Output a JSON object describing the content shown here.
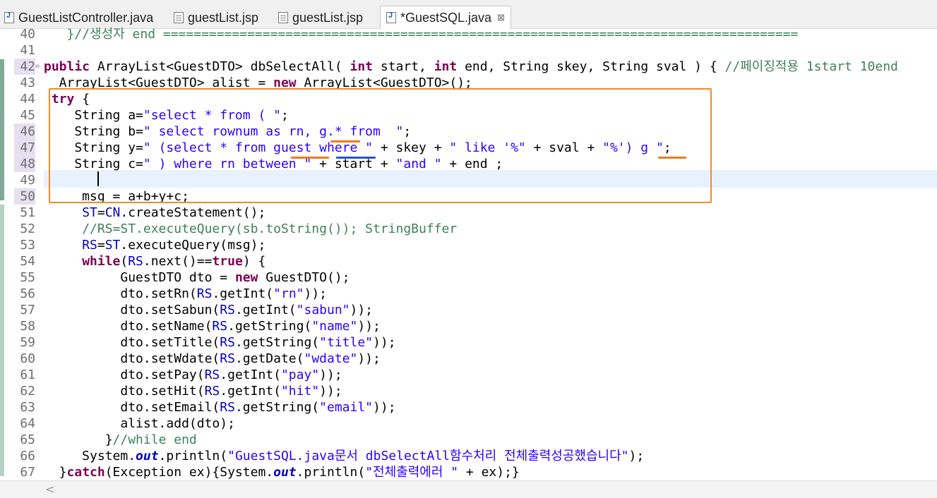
{
  "tabs": [
    {
      "label": "GuestListController.java",
      "type": "java-icon",
      "active": false
    },
    {
      "label": "guestList.jsp",
      "type": "jsp-icon",
      "active": false
    },
    {
      "label": "guestList.jsp",
      "type": "jsp-icon",
      "active": false
    },
    {
      "label": "*GuestSQL.java",
      "type": "java-icon",
      "active": true,
      "close": "⊠"
    }
  ],
  "lines": [
    {
      "n": "40",
      "segs": [
        [
          "cm",
          "   }//생성자 end ==================================================================================="
        ]
      ]
    },
    {
      "n": "41",
      "segs": [
        [
          "",
          ""
        ]
      ]
    },
    {
      "n": "42",
      "segs": [
        [
          "kw",
          "public"
        ],
        [
          "",
          " ArrayList<GuestDTO> dbSelectAll( "
        ],
        [
          "kw",
          "int"
        ],
        [
          "",
          " start, "
        ],
        [
          "kw",
          "int"
        ],
        [
          "",
          " end, String skey, String sval ) { "
        ],
        [
          "cm",
          "//페이징적용 1start 10end"
        ]
      ]
    },
    {
      "n": "43",
      "segs": [
        [
          "",
          "  ArrayList<GuestDTO> alist = "
        ],
        [
          "kw",
          "new"
        ],
        [
          "",
          " ArrayList<GuestDTO>();"
        ]
      ]
    },
    {
      "n": "44",
      "segs": [
        [
          "",
          ""
        ],
        [
          "kw",
          " try"
        ],
        [
          "",
          " {"
        ]
      ]
    },
    {
      "n": "45",
      "segs": [
        [
          "",
          "    String a="
        ],
        [
          "str",
          "\"select * from ( \""
        ],
        [
          "",
          ";"
        ]
      ]
    },
    {
      "n": "46",
      "segs": [
        [
          "",
          "    String b="
        ],
        [
          "str",
          "\" select rownum as rn, g.* from  \""
        ],
        [
          "",
          ";"
        ]
      ]
    },
    {
      "n": "47",
      "segs": [
        [
          "",
          "    String y="
        ],
        [
          "str",
          "\" (select * from guest where \""
        ],
        [
          "",
          " + skey + "
        ],
        [
          "str",
          "\" like '%\""
        ],
        [
          "",
          " + sval + "
        ],
        [
          "str",
          "\"%') g \""
        ],
        [
          "",
          ";"
        ]
      ]
    },
    {
      "n": "48",
      "segs": [
        [
          "",
          "    String c="
        ],
        [
          "str",
          "\" ) where rn between \""
        ],
        [
          "",
          " + start + "
        ],
        [
          "str",
          "\"and \""
        ],
        [
          "",
          " + end ;"
        ]
      ]
    },
    {
      "n": "49",
      "segs": [
        [
          "",
          ""
        ]
      ]
    },
    {
      "n": "50",
      "segs": [
        [
          "",
          "     msg = a+b+y+c;"
        ]
      ]
    },
    {
      "n": "51",
      "segs": [
        [
          "",
          "     "
        ],
        [
          "fld",
          "ST"
        ],
        [
          "",
          "="
        ],
        [
          "fld",
          "CN"
        ],
        [
          "",
          ".createStatement();"
        ]
      ]
    },
    {
      "n": "52",
      "segs": [
        [
          "",
          "     "
        ],
        [
          "cm",
          "//RS=ST.executeQuery(sb.toString()); StringBuffer"
        ]
      ]
    },
    {
      "n": "53",
      "segs": [
        [
          "",
          "     "
        ],
        [
          "fld",
          "RS"
        ],
        [
          "",
          "="
        ],
        [
          "fld",
          "ST"
        ],
        [
          "",
          ".executeQuery(msg);"
        ]
      ]
    },
    {
      "n": "54",
      "segs": [
        [
          "",
          "     "
        ],
        [
          "kw",
          "while"
        ],
        [
          "",
          "("
        ],
        [
          "fld",
          "RS"
        ],
        [
          "",
          ".next()=="
        ],
        [
          "kw",
          "true"
        ],
        [
          "",
          ") {"
        ]
      ]
    },
    {
      "n": "55",
      "segs": [
        [
          "",
          "          GuestDTO dto = "
        ],
        [
          "kw",
          "new"
        ],
        [
          "",
          " GuestDTO();"
        ]
      ]
    },
    {
      "n": "56",
      "segs": [
        [
          "",
          "          dto.setRn("
        ],
        [
          "fld",
          "RS"
        ],
        [
          "",
          ".getInt("
        ],
        [
          "str",
          "\"rn\""
        ],
        [
          "",
          "));"
        ]
      ]
    },
    {
      "n": "57",
      "segs": [
        [
          "",
          "          dto.setSabun("
        ],
        [
          "fld",
          "RS"
        ],
        [
          "",
          ".getInt("
        ],
        [
          "str",
          "\"sabun\""
        ],
        [
          "",
          "));"
        ]
      ]
    },
    {
      "n": "58",
      "segs": [
        [
          "",
          "          dto.setName("
        ],
        [
          "fld",
          "RS"
        ],
        [
          "",
          ".getString("
        ],
        [
          "str",
          "\"name\""
        ],
        [
          "",
          "));"
        ]
      ]
    },
    {
      "n": "59",
      "segs": [
        [
          "",
          "          dto.setTitle("
        ],
        [
          "fld",
          "RS"
        ],
        [
          "",
          ".getString("
        ],
        [
          "str",
          "\"title\""
        ],
        [
          "",
          "));"
        ]
      ]
    },
    {
      "n": "60",
      "segs": [
        [
          "",
          "          dto.setWdate("
        ],
        [
          "fld",
          "RS"
        ],
        [
          "",
          ".getDate("
        ],
        [
          "str",
          "\"wdate\""
        ],
        [
          "",
          "));"
        ]
      ]
    },
    {
      "n": "61",
      "segs": [
        [
          "",
          "          dto.setPay("
        ],
        [
          "fld",
          "RS"
        ],
        [
          "",
          ".getInt("
        ],
        [
          "str",
          "\"pay\""
        ],
        [
          "",
          "));"
        ]
      ]
    },
    {
      "n": "62",
      "segs": [
        [
          "",
          "          dto.setHit("
        ],
        [
          "fld",
          "RS"
        ],
        [
          "",
          ".getInt("
        ],
        [
          "str",
          "\"hit\""
        ],
        [
          "",
          "));"
        ]
      ]
    },
    {
      "n": "63",
      "segs": [
        [
          "",
          "          dto.setEmail("
        ],
        [
          "fld",
          "RS"
        ],
        [
          "",
          ".getString("
        ],
        [
          "str",
          "\"email\""
        ],
        [
          "",
          "));"
        ]
      ]
    },
    {
      "n": "64",
      "segs": [
        [
          "",
          "          alist.add(dto);"
        ]
      ]
    },
    {
      "n": "65",
      "segs": [
        [
          "",
          "        }"
        ],
        [
          "cm",
          "//while end"
        ]
      ]
    },
    {
      "n": "66",
      "segs": [
        [
          "",
          "     System."
        ],
        [
          "sfld",
          "out"
        ],
        [
          "",
          ".println("
        ],
        [
          "str",
          "\"GuestSQL.java문서 dbSelectAll함수처리 전체출력성공했습니다\""
        ],
        [
          "",
          ");"
        ]
      ]
    },
    {
      "n": "67",
      "segs": [
        [
          "",
          "  }"
        ],
        [
          "kw",
          "catch"
        ],
        [
          "",
          "(Exception ex){System."
        ],
        [
          "sfld",
          "out"
        ],
        [
          "",
          ".println("
        ],
        [
          "str",
          "\"전체출력에러 \""
        ],
        [
          "",
          " + ex);}"
        ]
      ]
    }
  ],
  "modified_lines": [
    "42",
    "46",
    "47",
    "48",
    "50"
  ],
  "colors": {
    "highlight_box": "#f08a2a",
    "underline_orange": "#f07a1a",
    "underline_blue": "#2a4fd6",
    "keyword": "#7f0055",
    "string": "#2a00ff",
    "comment": "#3f7f5f"
  }
}
